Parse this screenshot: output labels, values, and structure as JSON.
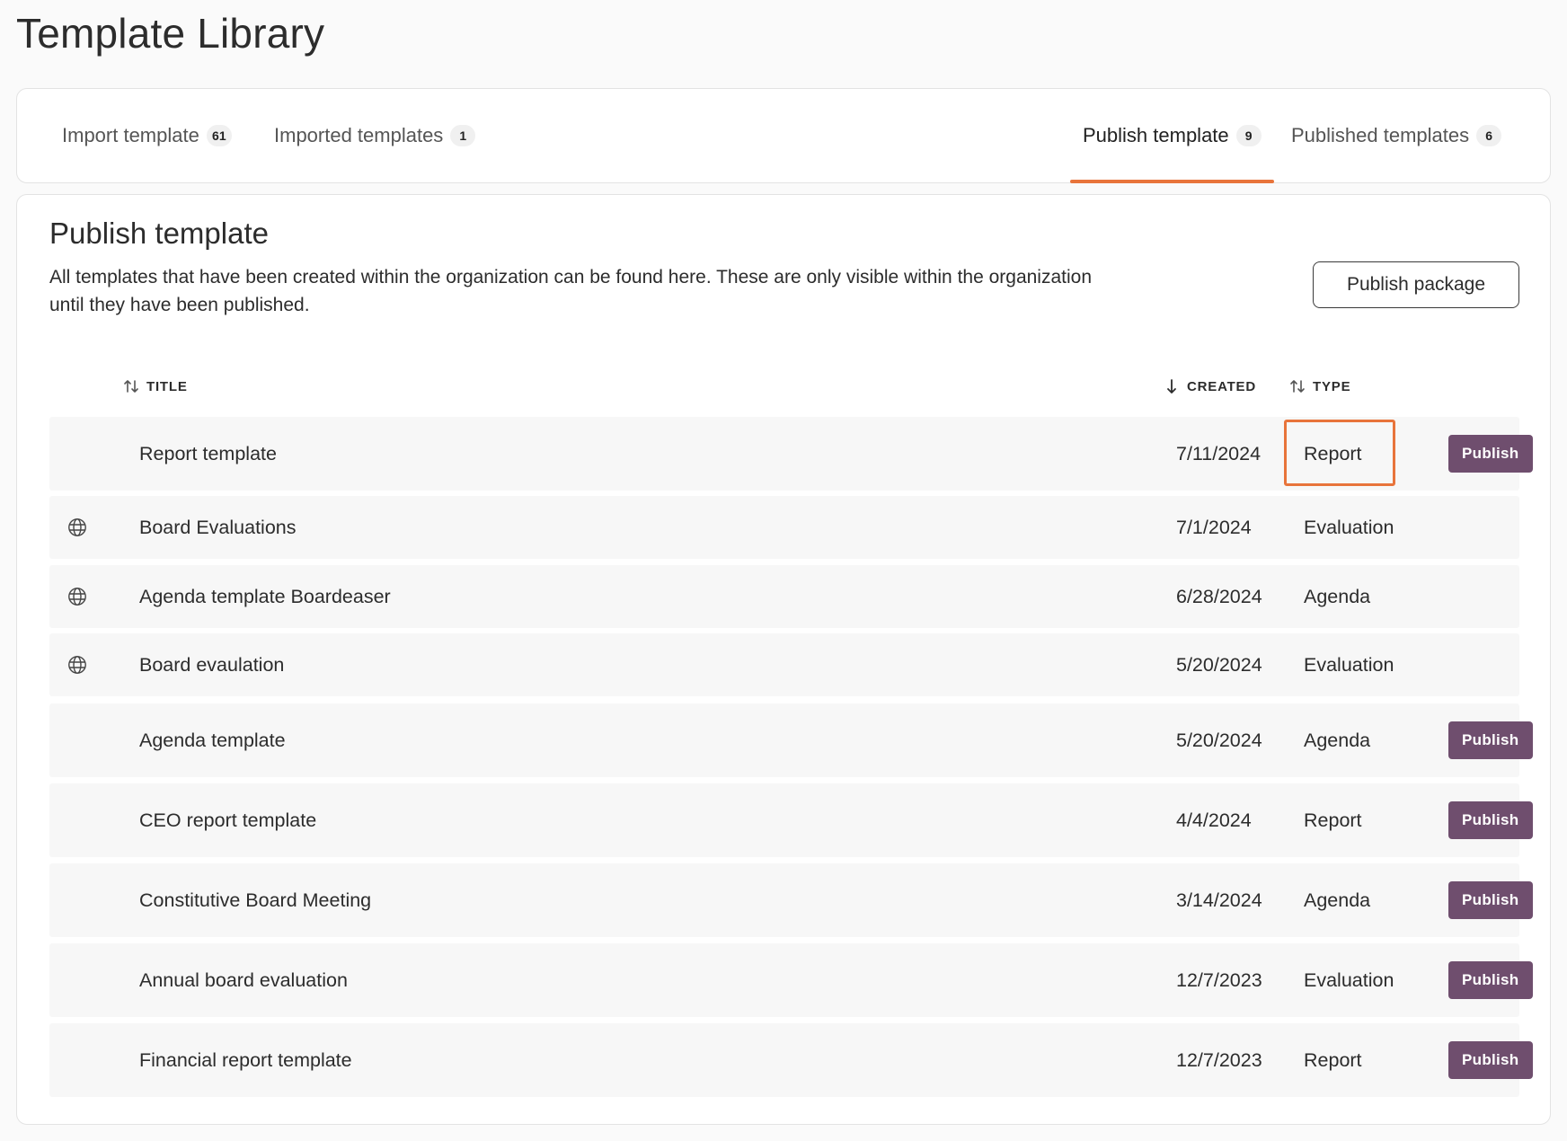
{
  "page": {
    "title": "Template Library"
  },
  "tabs": [
    {
      "label": "Import template",
      "count": "61",
      "active": false
    },
    {
      "label": "Imported templates",
      "count": "1",
      "active": false
    },
    {
      "label": "Publish template",
      "count": "9",
      "active": true
    },
    {
      "label": "Published templates",
      "count": "6",
      "active": false
    }
  ],
  "section": {
    "title": "Publish template",
    "description": "All templates that have been created within the organization can be found here. These are only visible within the organization until they have been published.",
    "publish_package_label": "Publish package"
  },
  "table": {
    "columns": {
      "title": "TITLE",
      "created": "CREATED",
      "type": "TYPE"
    },
    "sort": {
      "title": "unsorted",
      "created": "descending",
      "type": "unsorted"
    },
    "rows": [
      {
        "title": "Report template",
        "created": "7/11/2024",
        "type": "Report",
        "published_globally": false,
        "action": "Publish"
      },
      {
        "title": "Board Evaluations",
        "created": "7/1/2024",
        "type": "Evaluation",
        "published_globally": true,
        "action": ""
      },
      {
        "title": "Agenda template Boardeaser",
        "created": "6/28/2024",
        "type": "Agenda",
        "published_globally": true,
        "action": ""
      },
      {
        "title": "Board evaulation",
        "created": "5/20/2024",
        "type": "Evaluation",
        "published_globally": true,
        "action": ""
      },
      {
        "title": "Agenda template",
        "created": "5/20/2024",
        "type": "Agenda",
        "published_globally": false,
        "action": "Publish"
      },
      {
        "title": "CEO report template",
        "created": "4/4/2024",
        "type": "Report",
        "published_globally": false,
        "action": "Publish"
      },
      {
        "title": "Constitutive Board Meeting",
        "created": "3/14/2024",
        "type": "Agenda",
        "published_globally": false,
        "action": "Publish"
      },
      {
        "title": "Annual board evaluation",
        "created": "12/7/2023",
        "type": "Evaluation",
        "published_globally": false,
        "action": "Publish"
      },
      {
        "title": "Financial report template",
        "created": "12/7/2023",
        "type": "Report",
        "published_globally": false,
        "action": "Publish"
      }
    ]
  },
  "icons": {
    "sort_unsorted": "sort-icon",
    "sort_desc": "arrow-down-icon",
    "published": "globe-icon"
  },
  "colors": {
    "accent": "#e8743b",
    "publish_button": "#6f4e6e",
    "row_background": "#f7f7f7"
  }
}
